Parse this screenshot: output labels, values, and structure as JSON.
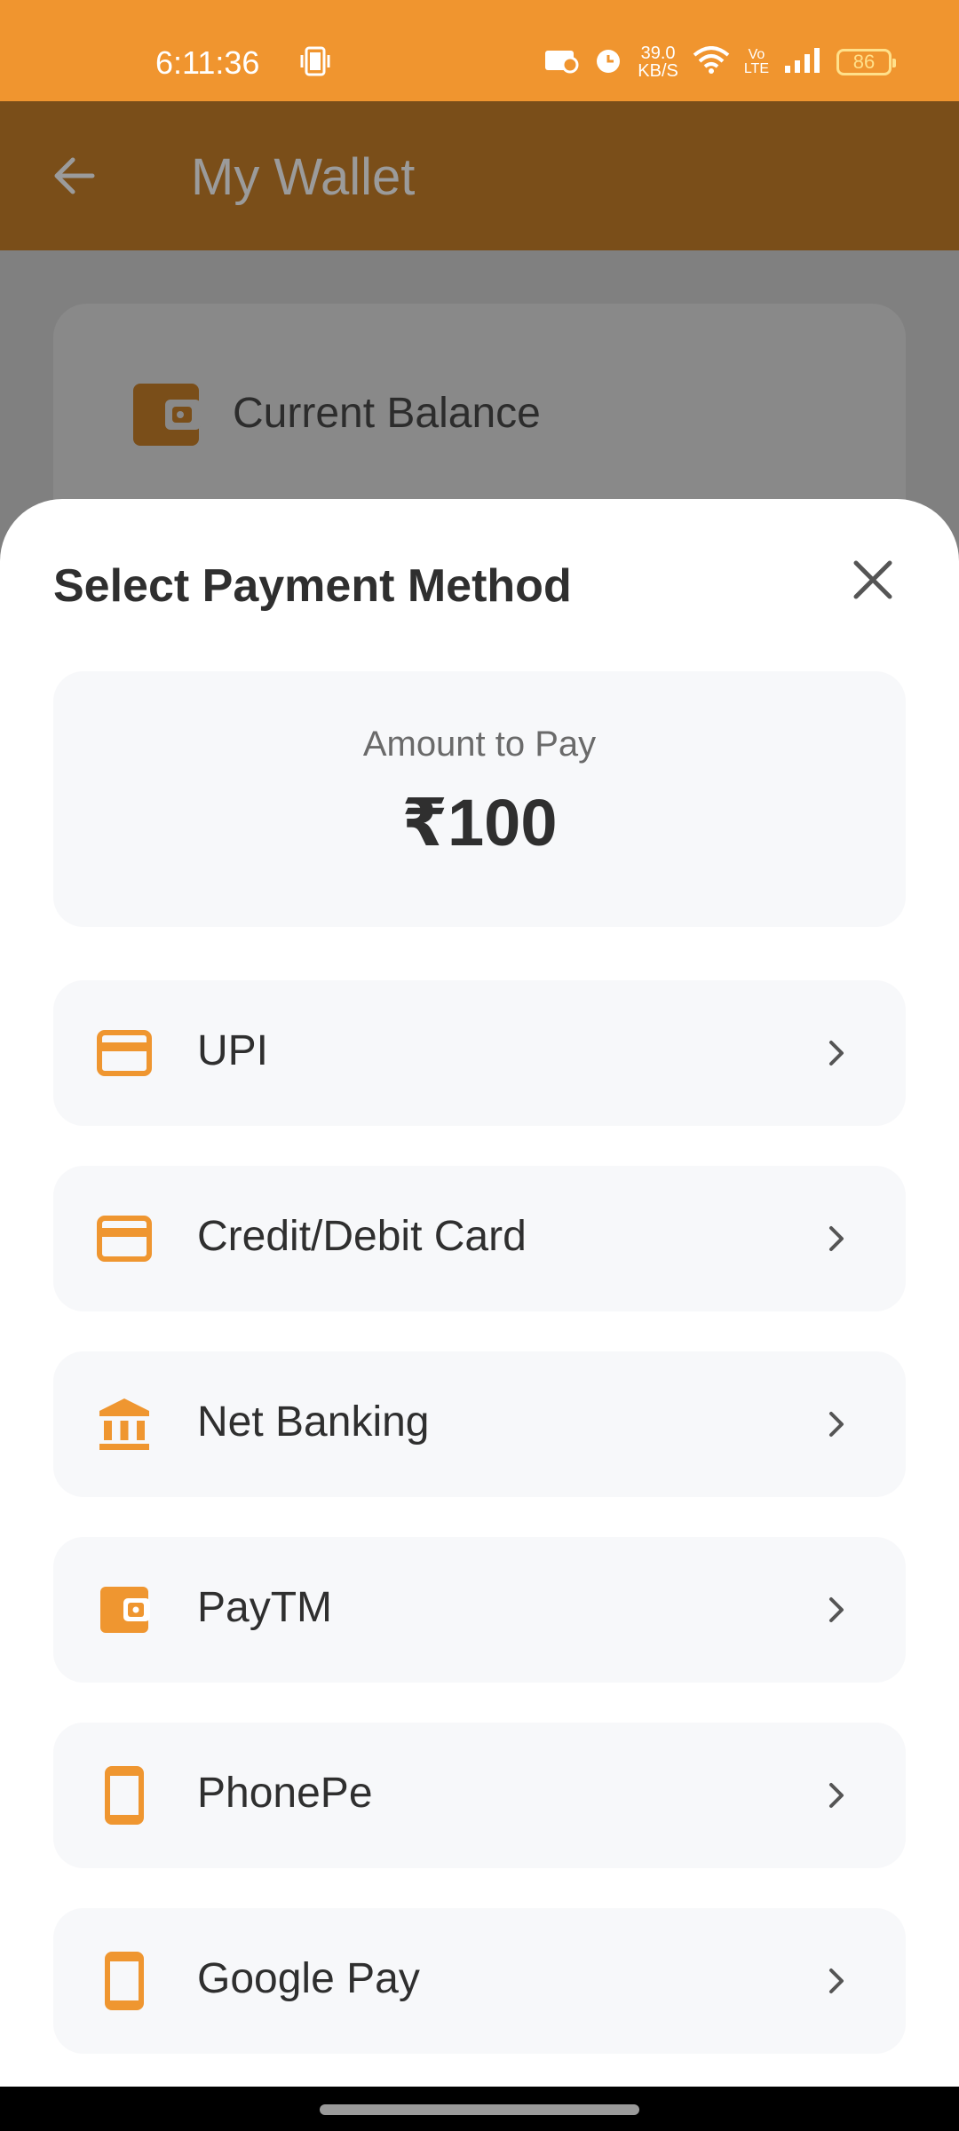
{
  "status_bar": {
    "time": "6:11:36",
    "net_speed_value": "39.0",
    "net_speed_unit": "KB/S",
    "volte_top": "Vo",
    "volte_bottom": "LTE",
    "battery": "86"
  },
  "app_bar": {
    "title": "My Wallet"
  },
  "balance_card": {
    "label": "Current Balance"
  },
  "sheet": {
    "title": "Select Payment Method",
    "amount_label": "Amount to Pay",
    "amount_value": "₹100",
    "methods": [
      {
        "label": "UPI",
        "icon": "card-icon"
      },
      {
        "label": "Credit/Debit Card",
        "icon": "card-icon"
      },
      {
        "label": "Net Banking",
        "icon": "bank-icon"
      },
      {
        "label": "PayTM",
        "icon": "wallet-icon"
      },
      {
        "label": "PhonePe",
        "icon": "phone-icon"
      },
      {
        "label": "Google Pay",
        "icon": "phone-icon"
      }
    ]
  },
  "colors": {
    "status_bar": "#F0952F",
    "app_bar_dimmed": "#7A4E19",
    "accent": "#EF9630",
    "overlay": "#808080",
    "card_bg": "#F7F8FA"
  }
}
